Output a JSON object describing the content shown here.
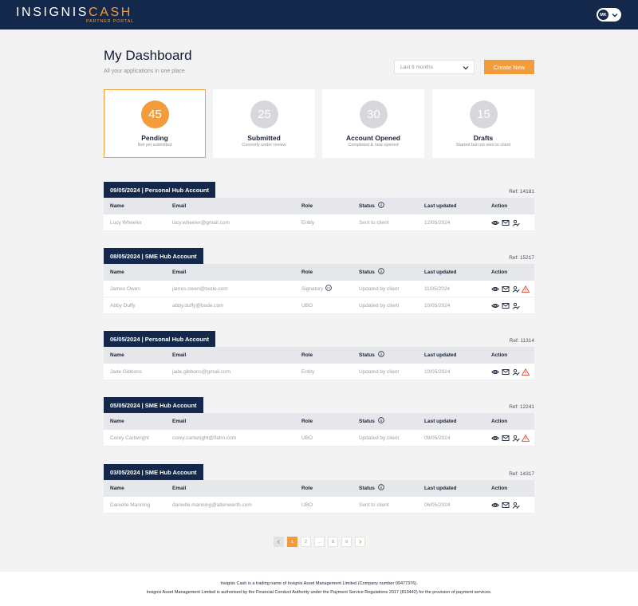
{
  "header": {
    "logo_part1": "INSIGNIS",
    "logo_part2": "CASH",
    "logo_sub": "PARTNER PORTAL",
    "user_initials": "MK",
    "brand_color": "#13284b",
    "accent_color": "#f39c3c"
  },
  "dashboard": {
    "title": "My Dashboard",
    "subtitle": "All your applications in one place",
    "filter_value": "Last 6 months",
    "create_label": "Create New"
  },
  "stats": [
    {
      "count": "45",
      "label": "Pending",
      "sub": "Not yet submitted",
      "active": true
    },
    {
      "count": "25",
      "label": "Submitted",
      "sub": "Currently under review",
      "active": false
    },
    {
      "count": "30",
      "label": "Account Opened",
      "sub": "Completed & now opened",
      "active": false
    },
    {
      "count": "15",
      "label": "Drafts",
      "sub": "Started but not sent to client",
      "active": false
    }
  ],
  "table_headers": {
    "name": "Name",
    "email": "Email",
    "role": "Role",
    "status": "Status",
    "updated": "Last updated",
    "action": "Action"
  },
  "groups": [
    {
      "title": "09/05/2024  |  Personal Hub Account",
      "ref": "Ref: 14181",
      "rows": [
        {
          "name": "Lucy Wheeler",
          "email": "lucy.wheeler@gmail.com",
          "role": "Entity",
          "status": "Sent to client",
          "updated": "12/05/2024",
          "warning": false,
          "role_more": false
        }
      ]
    },
    {
      "title": "08/05/2024  |  SME Hub Account",
      "ref": "Ref: 15217",
      "rows": [
        {
          "name": "James Owen",
          "email": "james.owen@bode.com",
          "role": "Signatory",
          "status": "Updated by client",
          "updated": "11/05/2024",
          "warning": true,
          "role_more": true
        },
        {
          "name": "Abby Duffy",
          "email": "abby.duffy@bode.com",
          "role": "UBO",
          "status": "Updated by client",
          "updated": "10/05/2024",
          "warning": false,
          "role_more": false
        }
      ]
    },
    {
      "title": "06/05/2024  |  Personal Hub Account",
      "ref": "Ref: 11314",
      "rows": [
        {
          "name": "Jade Gibbons",
          "email": "jade.gibbons@gmail.com",
          "role": "Entity",
          "status": "Updated by client",
          "updated": "10/05/2024",
          "warning": true,
          "role_more": false
        }
      ]
    },
    {
      "title": "05/05/2024  |  SME Hub Account",
      "ref": "Ref: 12241",
      "rows": [
        {
          "name": "Corey Cartwright",
          "email": "corey.cartwright@lfahn.com",
          "role": "UBO",
          "status": "Updated by client",
          "updated": "09/05/2024",
          "warning": true,
          "role_more": false
        }
      ]
    },
    {
      "title": "03/05/2024  |  SME Hub Account",
      "ref": "Ref: 14317",
      "rows": [
        {
          "name": "Danielle Manning",
          "email": "danielle.manning@altenwerth.com",
          "role": "UBO",
          "status": "Sent to client",
          "updated": "06/05/2024",
          "warning": false,
          "role_more": false
        }
      ]
    }
  ],
  "pagination": {
    "pages": [
      "1",
      "2",
      "...",
      "8",
      "9"
    ],
    "current": "1"
  },
  "footer": {
    "line1": "Insignis Cash is a trading name of Insignis Asset Management Limited (Company number 09477376).",
    "line2": "Insignis Asset Management Limited is authorised by the Financial Conduct Authority under the Payment Service Regulations 2017 (813442) for the provision of payment services."
  }
}
